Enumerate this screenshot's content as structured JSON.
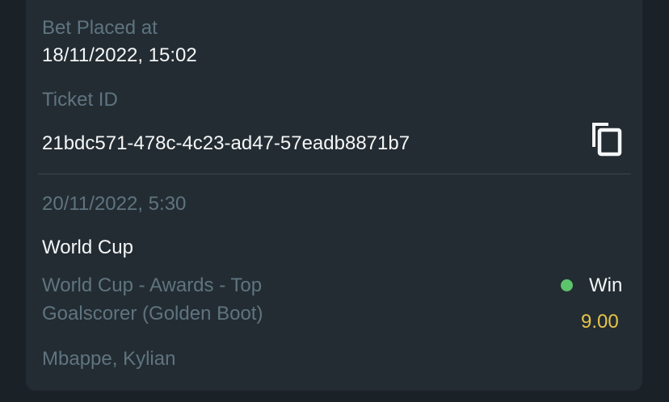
{
  "bet": {
    "placed_label": "Bet Placed at",
    "placed_value": "18/11/2022, 15:02",
    "ticket_label": "Ticket ID",
    "ticket_value": "21bdc571-478c-4c23-ad47-57eadb8871b7",
    "copy_icon": "copy-icon"
  },
  "selection": {
    "event_datetime": "20/11/2022, 5:30",
    "competition": "World Cup",
    "market_line1": "World Cup - Awards - Top",
    "market_line2": "Goalscorer (Golden Boot)",
    "pick": "Mbappe, Kylian",
    "status": "Win",
    "status_color": "#5cc46a",
    "odds": "9.00",
    "odds_color": "#e8c34a"
  }
}
